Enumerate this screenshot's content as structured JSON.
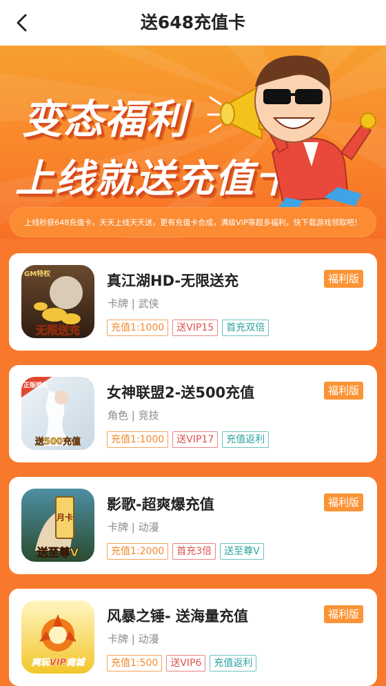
{
  "nav": {
    "title": "送648充值卡"
  },
  "banner": {
    "headline1": "变态福利",
    "headline2": "上线就送充值卡!",
    "notice": "上线秒获648充值卡，天天上线天天送，更有充值卡合成，满级VIP等超多福利，快下载游戏领取吧！"
  },
  "colors": {
    "accent": "#f8792b",
    "tag_orange": "#f08a2a",
    "tag_red": "#e0514e",
    "tag_teal": "#2aa3a0",
    "badge": "#fb9436"
  },
  "games": [
    {
      "name": "真江湖HD-无限送充",
      "category": "卡牌 | 武侠",
      "badge": "福利版",
      "tags": [
        "充值1:1000",
        "送VIP15",
        "首充双倍"
      ],
      "icon_label": "无限送充",
      "icon_corner": "GM特权"
    },
    {
      "name": "女神联盟2-送500充值",
      "category": "角色 | 竞技",
      "badge": "福利版",
      "tags": [
        "充值1:1000",
        "送VIP17",
        "充值返利"
      ],
      "icon_label": "送500充值",
      "icon_corner": "正版授权"
    },
    {
      "name": "影歌-超爽爆充值",
      "category": "卡牌 | 动漫",
      "badge": "福利版",
      "tags": [
        "充值1:2000",
        "首充3倍",
        "送至尊V"
      ],
      "icon_label": "送至尊V",
      "icon_corner": "月卡"
    },
    {
      "name": "风暴之锤- 送海量充值",
      "category": "卡牌 | 动漫",
      "badge": "福利版",
      "tags": [
        "充值1:500",
        "送VIP6",
        "充值返利"
      ],
      "icon_label": "爽玩VIP商城",
      "icon_corner": ""
    }
  ]
}
